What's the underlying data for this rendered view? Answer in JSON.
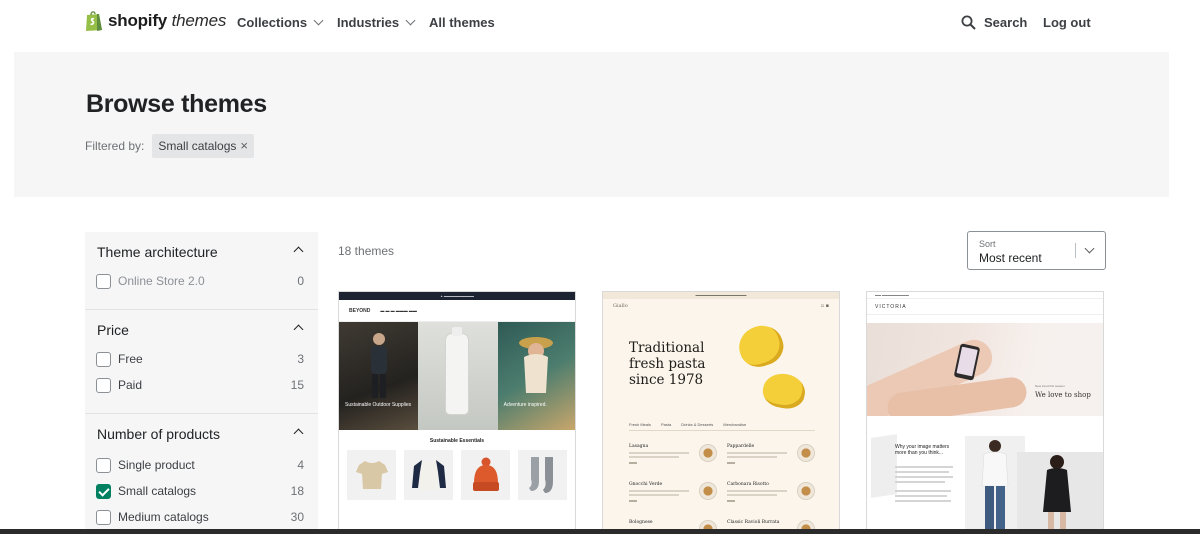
{
  "header": {
    "logo_main": "shopify",
    "logo_sub": "themes",
    "nav": [
      {
        "label": "Collections",
        "has_dropdown": true
      },
      {
        "label": "Industries",
        "has_dropdown": true
      },
      {
        "label": "All themes",
        "has_dropdown": false
      }
    ],
    "search_label": "Search",
    "logout_label": "Log out"
  },
  "hero": {
    "title": "Browse themes",
    "filtered_by_label": "Filtered by:",
    "active_filter": "Small catalogs",
    "remove_glyph": "×"
  },
  "sidebar": {
    "groups": [
      {
        "title": "Theme architecture",
        "options": [
          {
            "label": "Online Store 2.0",
            "count": "0",
            "checked": false
          }
        ]
      },
      {
        "title": "Price",
        "options": [
          {
            "label": "Free",
            "count": "3",
            "checked": false
          },
          {
            "label": "Paid",
            "count": "15",
            "checked": false
          }
        ]
      },
      {
        "title": "Number of products",
        "options": [
          {
            "label": "Single product",
            "count": "4",
            "checked": false
          },
          {
            "label": "Small catalogs",
            "count": "18",
            "checked": true
          },
          {
            "label": "Medium catalogs",
            "count": "30",
            "checked": false
          }
        ]
      }
    ]
  },
  "results": {
    "count_label": "18 themes",
    "sort_label": "Sort",
    "sort_value": "Most recent"
  },
  "themes": [
    {
      "name": "Beyond",
      "brand": "BEYOND",
      "hero_caption_1": "Sustainable Outdoor Supplies",
      "hero_caption_2": "Adventure inspired.",
      "section_title": "Sustainable Essentials"
    },
    {
      "name": "Giallo",
      "brand": "Giallo",
      "headline_1": "Traditional",
      "headline_2": "fresh pasta",
      "headline_3": "since 1978",
      "tabs": [
        "Fresh Meals",
        "Pasta",
        "Drinks & Desserts",
        "Merchandise"
      ],
      "menu_items": [
        "Lasagna",
        "Pappardelle",
        "Gnocchi Verde",
        "Carbonara Risotto",
        "Bolognese",
        "Classic Ravioli Burrata"
      ]
    },
    {
      "name": "Victoria",
      "brand": "VICTORIA",
      "hero_kicker": "New trend this season",
      "hero_heading": "We love to shop",
      "section_heading": "Why your image matters more than you think..."
    }
  ],
  "colors": {
    "accent": "#008060",
    "hero_bg": "#f6f6f7",
    "text": "#202223"
  }
}
